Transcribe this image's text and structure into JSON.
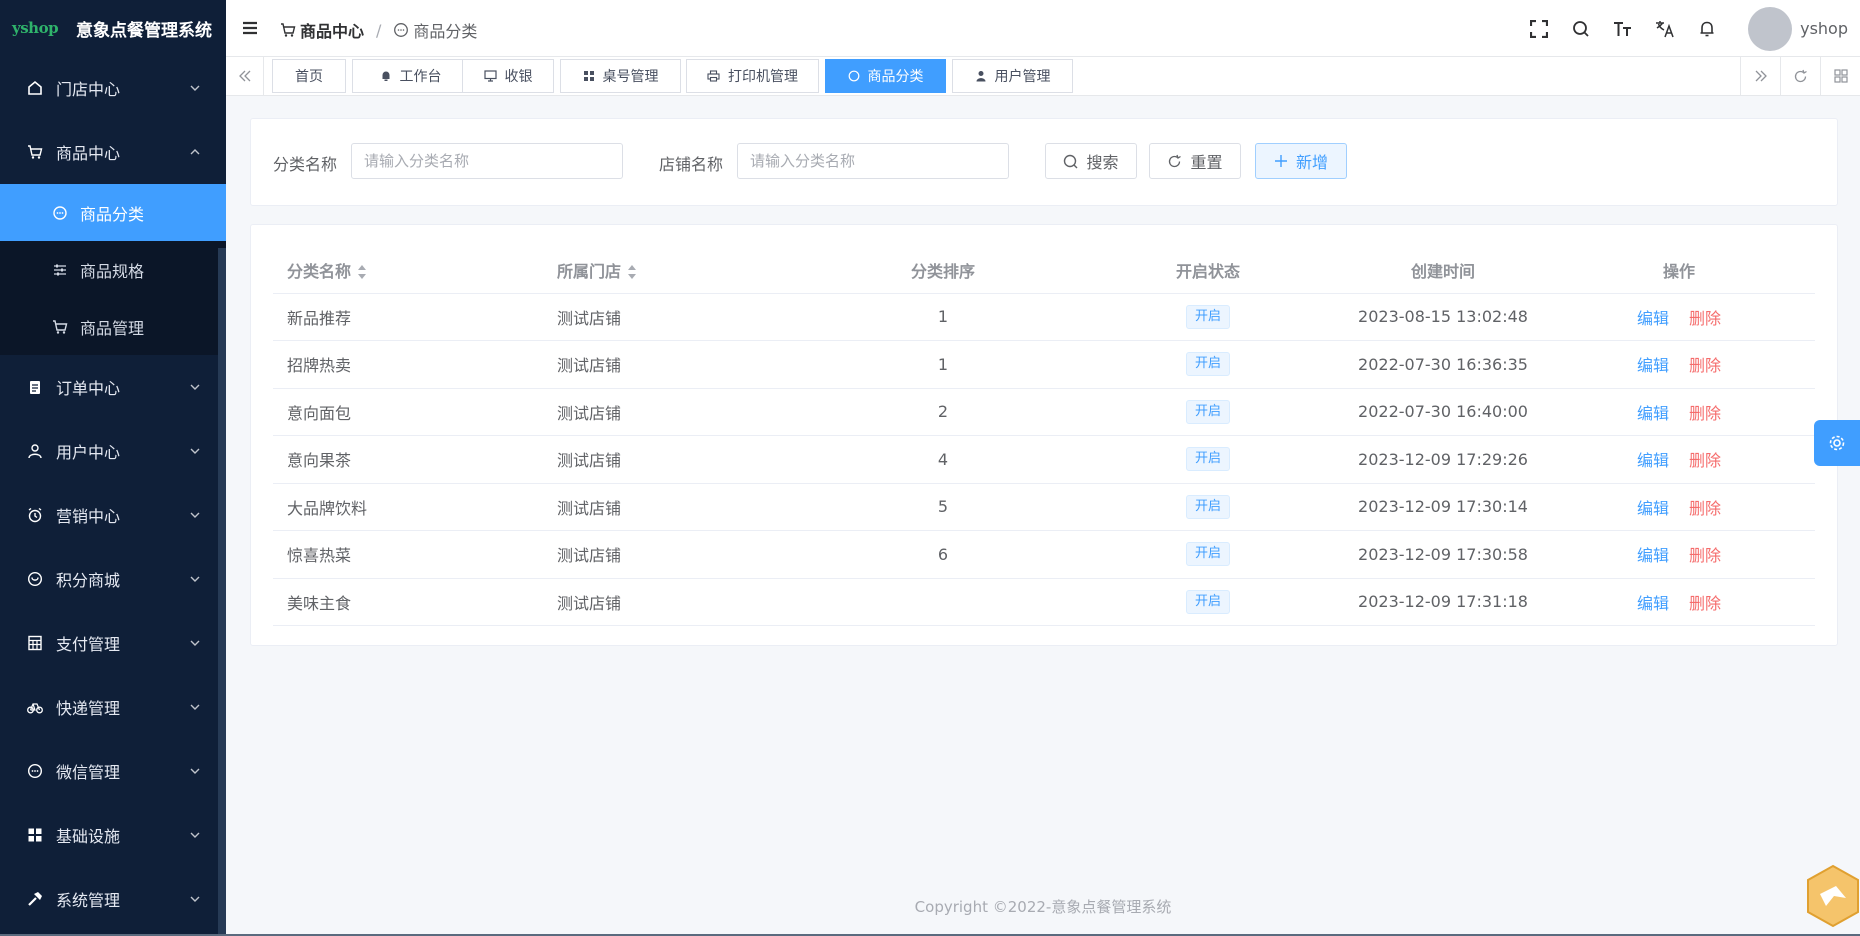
{
  "app": {
    "logo_text": "yshop",
    "title": "意象点餐管理系统"
  },
  "sidebar": {
    "items": [
      {
        "label": "门店中心"
      },
      {
        "label": "商品中心"
      },
      {
        "label": "订单中心"
      },
      {
        "label": "用户中心"
      },
      {
        "label": "营销中心"
      },
      {
        "label": "积分商城"
      },
      {
        "label": "支付管理"
      },
      {
        "label": "快递管理"
      },
      {
        "label": "微信管理"
      },
      {
        "label": "基础设施"
      },
      {
        "label": "系统管理"
      }
    ],
    "sub_items": [
      {
        "label": "商品分类"
      },
      {
        "label": "商品规格"
      },
      {
        "label": "商品管理"
      }
    ]
  },
  "header": {
    "breadcrumb": [
      "商品中心",
      "商品分类"
    ],
    "username": "yshop"
  },
  "tabs": [
    {
      "label": "首页"
    },
    {
      "label": "工作台"
    },
    {
      "label": "收银"
    },
    {
      "label": "桌号管理"
    },
    {
      "label": "打印机管理"
    },
    {
      "label": "商品分类"
    },
    {
      "label": "用户管理"
    }
  ],
  "search": {
    "name_label": "分类名称",
    "name_placeholder": "请输入分类名称",
    "store_label": "店铺名称",
    "store_placeholder": "请输入分类名称",
    "search_btn": "搜索",
    "reset_btn": "重置",
    "add_btn": "新增"
  },
  "table": {
    "columns": [
      "分类名称",
      "所属门店",
      "分类排序",
      "开启状态",
      "创建时间",
      "操作"
    ],
    "edit_label": "编辑",
    "delete_label": "删除",
    "rows": [
      {
        "name": "新品推荐",
        "store": "测试店铺",
        "sort": "1",
        "status": "开启",
        "created": "2023-08-15 13:02:48"
      },
      {
        "name": "招牌热卖",
        "store": "测试店铺",
        "sort": "1",
        "status": "开启",
        "created": "2022-07-30 16:36:35"
      },
      {
        "name": "意向面包",
        "store": "测试店铺",
        "sort": "2",
        "status": "开启",
        "created": "2022-07-30 16:40:00"
      },
      {
        "name": "意向果茶",
        "store": "测试店铺",
        "sort": "4",
        "status": "开启",
        "created": "2023-12-09 17:29:26"
      },
      {
        "name": "大品牌饮料",
        "store": "测试店铺",
        "sort": "5",
        "status": "开启",
        "created": "2023-12-09 17:30:14"
      },
      {
        "name": "惊喜热菜",
        "store": "测试店铺",
        "sort": "6",
        "status": "开启",
        "created": "2023-12-09 17:30:58"
      },
      {
        "name": "美味主食",
        "store": "测试店铺",
        "sort": "",
        "status": "开启",
        "created": "2023-12-09 17:31:18"
      }
    ]
  },
  "footer": "Copyright ©2022-意象点餐管理系统",
  "colors": {
    "primary": "#409eff",
    "sidebar_bg": "#0f1f38",
    "danger": "#f56c6c"
  }
}
